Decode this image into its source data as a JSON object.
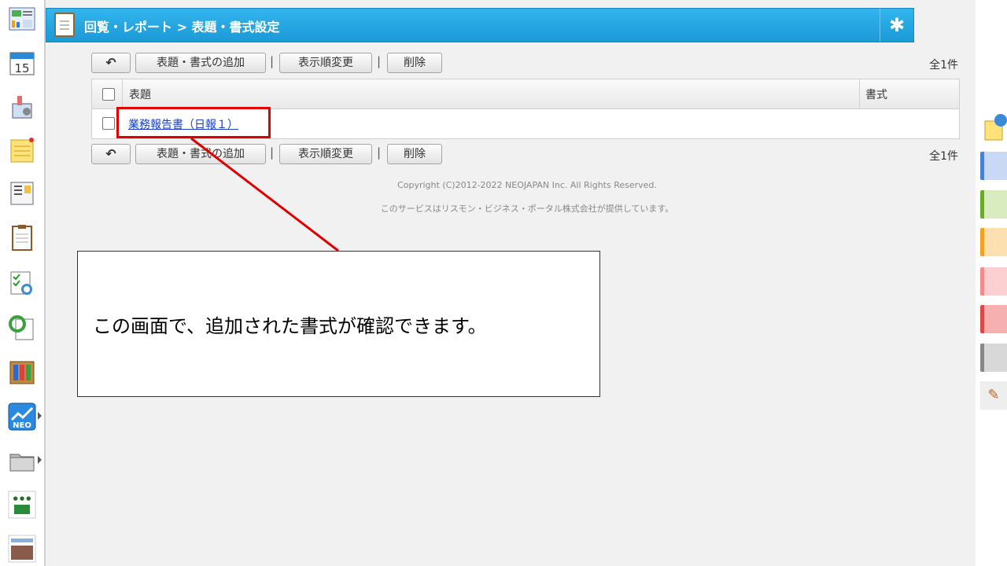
{
  "header": {
    "title": "回覧・レポート > 表題・書式設定",
    "doc_icon": "clipboard-icon",
    "settings_icon": "gear-icon"
  },
  "toolbar": {
    "back_icon": "back-arrow-icon",
    "add_label": "表題・書式の追加",
    "sep": "|",
    "order_label": "表示順変更",
    "delete_label": "削除",
    "count": "全1件"
  },
  "table": {
    "col_title": "表題",
    "col_format": "書式",
    "rows": [
      {
        "title": "業務報告書（日報１）",
        "format": ""
      }
    ]
  },
  "footer": {
    "copyright": "Copyright (C)2012-2022 NEOJAPAN Inc. All Rights Reserved.",
    "provider": "このサービスはリスモン・ビジネス・ポータル株式会社が提供しています。"
  },
  "callout": {
    "text": "この画面で、追加された書式が確認できます。"
  },
  "sidebar": {
    "items": [
      {
        "icon": "portal-icon"
      },
      {
        "icon": "calendar-icon",
        "label": "15"
      },
      {
        "icon": "facility-icon"
      },
      {
        "icon": "memo-icon"
      },
      {
        "icon": "bulletin-icon"
      },
      {
        "icon": "report-icon"
      },
      {
        "icon": "checklist-icon"
      },
      {
        "icon": "workflow-icon"
      },
      {
        "icon": "binder-icon"
      },
      {
        "icon": "neo-icon",
        "label": "NEO"
      },
      {
        "icon": "folder-icon"
      },
      {
        "icon": "link-icon"
      },
      {
        "icon": "link-icon"
      }
    ]
  },
  "colors": {
    "accent": "#1a9ad6",
    "highlight": "#e00000",
    "tabs": [
      "#4a7fd8",
      "#6aa830",
      "#f5a020",
      "#f48a8a",
      "#e04848",
      "#888888"
    ]
  }
}
